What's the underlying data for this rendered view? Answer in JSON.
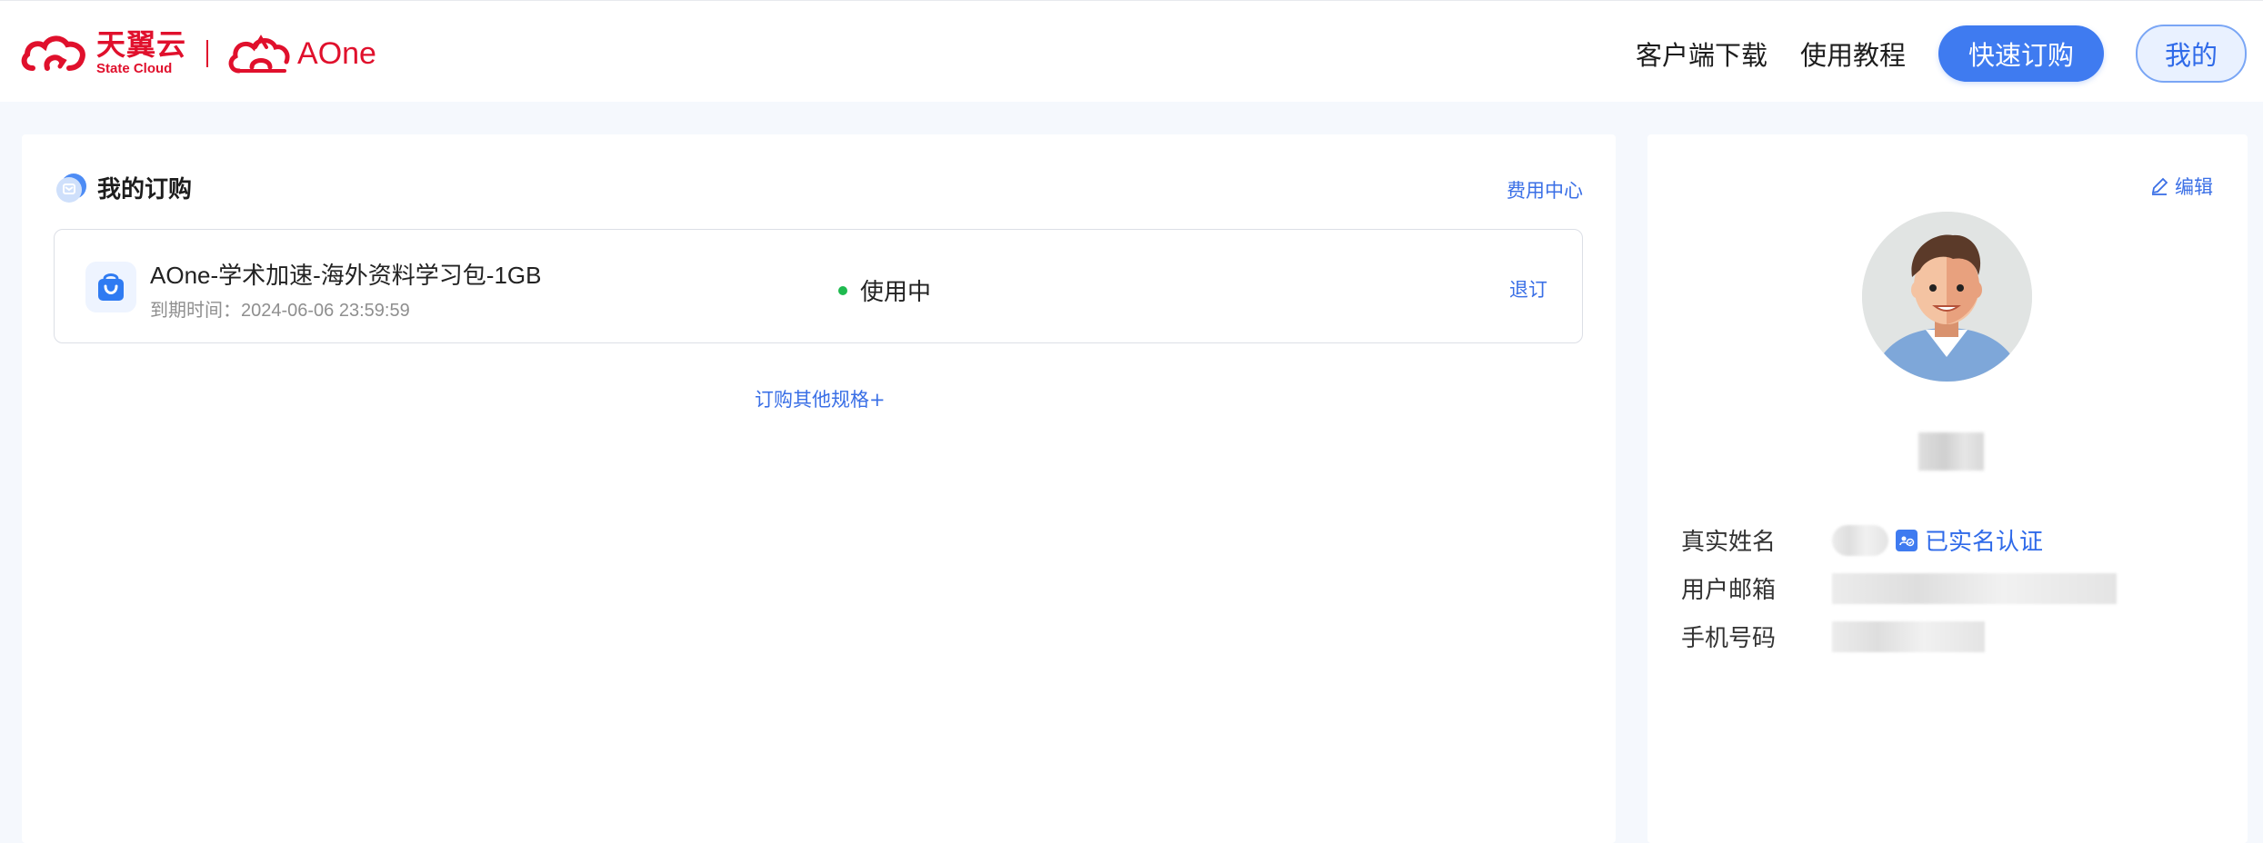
{
  "header": {
    "brand_main": "天翼云",
    "brand_sub": "State Cloud",
    "brand_product": "AOne",
    "nav": {
      "download": "客户端下载",
      "tutorial": "使用教程",
      "quick_buy": "快速订购",
      "mine": "我的"
    }
  },
  "orders": {
    "title": "我的订购",
    "fee_center": "费用中心",
    "items": [
      {
        "name": "AOne-学术加速-海外资料学习包-1GB",
        "expiry": "到期时间：2024-06-06 23:59:59",
        "status": "使用中",
        "action": "退订"
      }
    ],
    "more_specs": "订购其他规格+"
  },
  "profile": {
    "edit": "编辑",
    "labels": {
      "real_name": "真实姓名",
      "email": "用户邮箱",
      "phone": "手机号码"
    },
    "verified": "已实名认证"
  },
  "colors": {
    "brand_red": "#e0102c",
    "accent_blue": "#3f7bf0",
    "link_blue": "#3a6fe6",
    "status_green": "#1fba4f"
  }
}
